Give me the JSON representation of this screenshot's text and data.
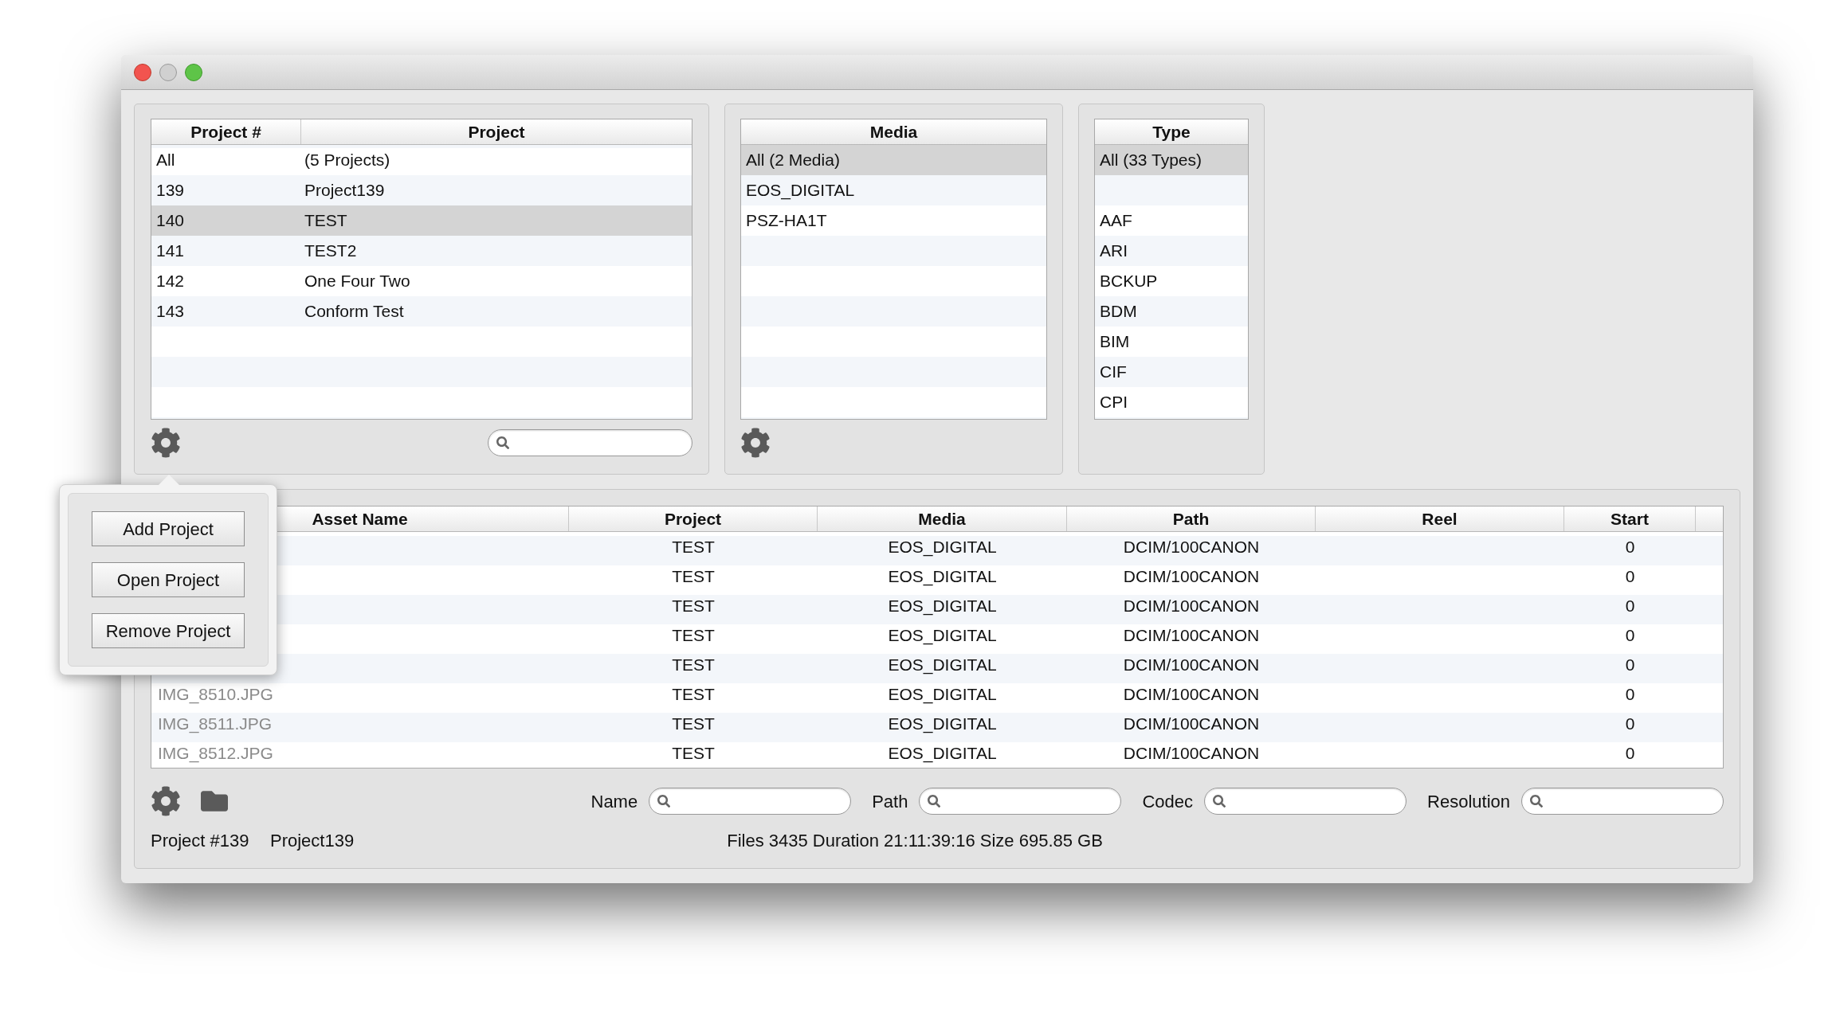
{
  "projects": {
    "columns": [
      "Project #",
      "Project"
    ],
    "rows": [
      {
        "number": "All",
        "name": "(5 Projects)",
        "selected": false
      },
      {
        "number": "139",
        "name": "Project139",
        "selected": false
      },
      {
        "number": "140",
        "name": "TEST",
        "selected": true
      },
      {
        "number": "141",
        "name": "TEST2",
        "selected": false
      },
      {
        "number": "142",
        "name": "One Four Two",
        "selected": false
      },
      {
        "number": "143",
        "name": "Conform Test",
        "selected": false
      }
    ]
  },
  "media": {
    "columns": [
      "Media"
    ],
    "rows": [
      {
        "name": "All (2 Media)",
        "selected": true
      },
      {
        "name": "EOS_DIGITAL",
        "selected": false
      },
      {
        "name": "PSZ-HA1T",
        "selected": false
      }
    ]
  },
  "types": {
    "columns": [
      "Type"
    ],
    "rows": [
      {
        "kind": "entry",
        "name": "All (33 Types)",
        "selected": true
      },
      {
        "kind": "blank"
      },
      {
        "kind": "entry",
        "name": "AAF",
        "selected": false
      },
      {
        "kind": "entry",
        "name": "ARI",
        "selected": false
      },
      {
        "kind": "entry",
        "name": "BCKUP",
        "selected": false
      },
      {
        "kind": "entry",
        "name": "BDM",
        "selected": false
      },
      {
        "kind": "entry",
        "name": "BIM",
        "selected": false
      },
      {
        "kind": "entry",
        "name": "CIF",
        "selected": false
      },
      {
        "kind": "entry",
        "name": "CPI",
        "selected": false
      }
    ]
  },
  "popover": {
    "buttons": [
      "Add Project",
      "Open Project",
      "Remove Project"
    ]
  },
  "assets": {
    "columns": [
      "Asset Name",
      "Project",
      "Media",
      "Path",
      "Reel",
      "Start"
    ],
    "rows": [
      {
        "project": "TEST",
        "media": "EOS_DIGITAL",
        "path": "DCIM/100CANON",
        "start": "0"
      },
      {
        "project": "TEST",
        "media": "EOS_DIGITAL",
        "path": "DCIM/100CANON",
        "start": "0"
      },
      {
        "project": "TEST",
        "media": "EOS_DIGITAL",
        "path": "DCIM/100CANON",
        "start": "0"
      },
      {
        "project": "TEST",
        "media": "EOS_DIGITAL",
        "path": "DCIM/100CANON",
        "start": "0"
      },
      {
        "project": "TEST",
        "media": "EOS_DIGITAL",
        "path": "DCIM/100CANON",
        "start": "0"
      },
      {
        "asset_name": "IMG_8510.JPG",
        "project": "TEST",
        "media": "EOS_DIGITAL",
        "path": "DCIM/100CANON",
        "start": "0"
      },
      {
        "asset_name": "IMG_8511.JPG",
        "project": "TEST",
        "media": "EOS_DIGITAL",
        "path": "DCIM/100CANON",
        "start": "0"
      },
      {
        "asset_name": "IMG_8512.JPG",
        "project": "TEST",
        "media": "EOS_DIGITAL",
        "path": "DCIM/100CANON",
        "start": "0"
      }
    ]
  },
  "filters": [
    {
      "label": "Name"
    },
    {
      "label": "Path"
    },
    {
      "label": "Codec"
    },
    {
      "label": "Resolution"
    }
  ],
  "status": {
    "project_number": "Project #139",
    "project_name": "Project139",
    "summary": "Files 3435 Duration 21:11:39:16 Size 695.85 GB"
  }
}
